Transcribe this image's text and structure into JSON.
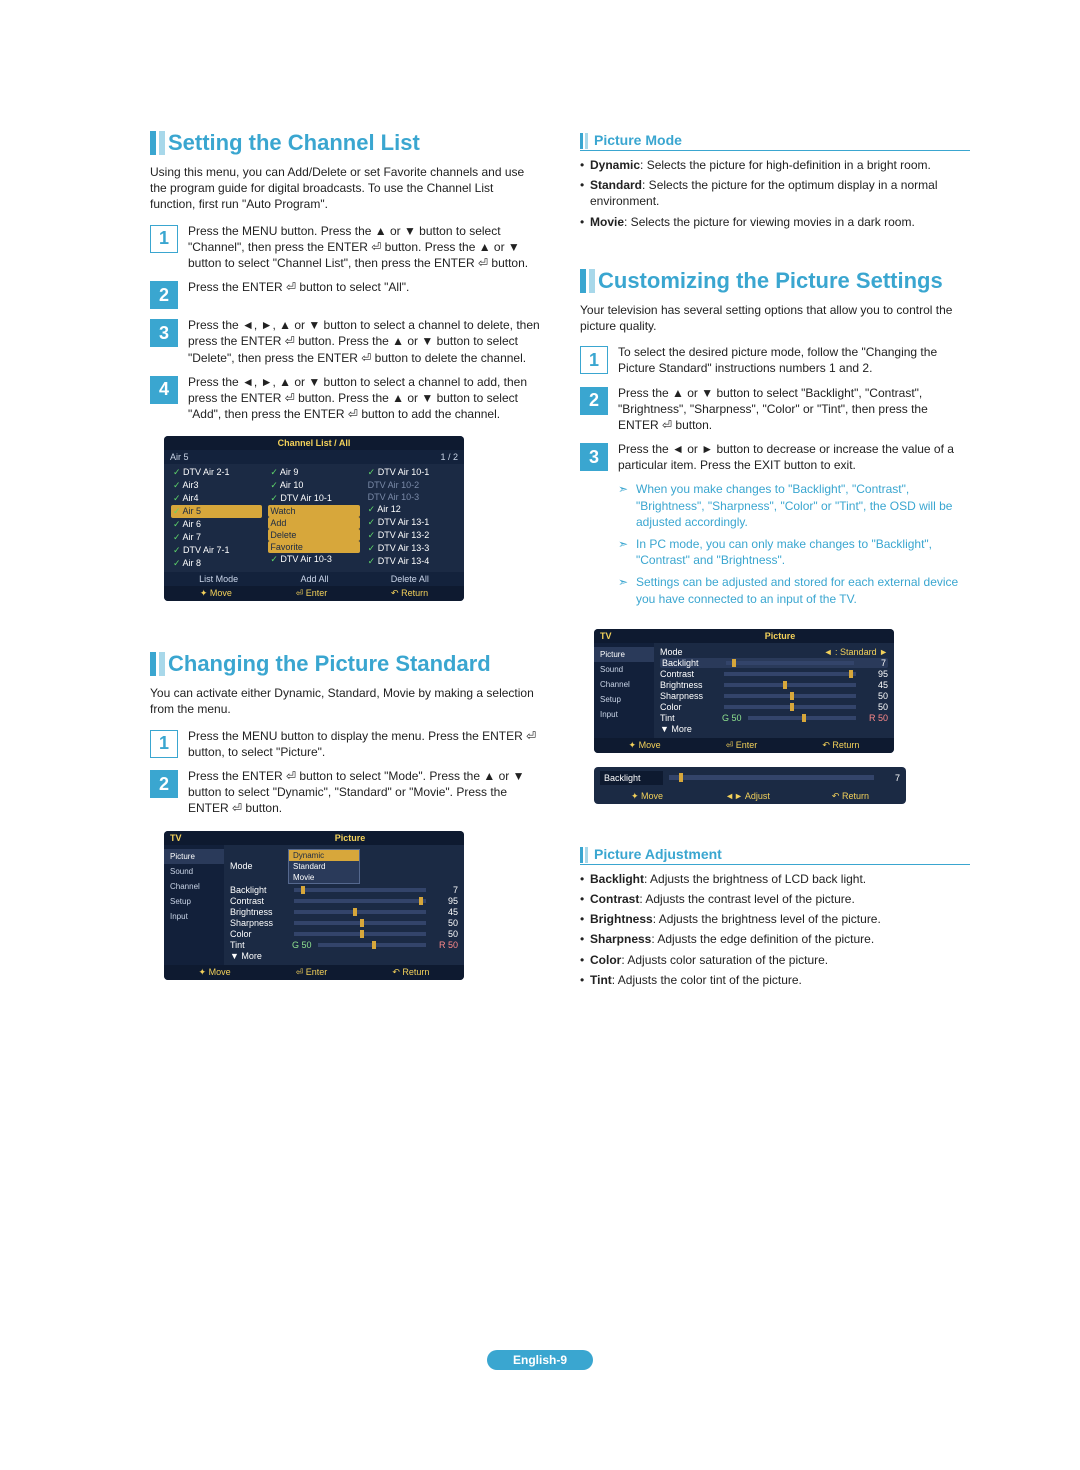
{
  "left": {
    "h1a": "Setting the Channel List",
    "intro_a": "Using this menu, you can Add/Delete or set Favorite channels and use the program guide for digital broadcasts. To use the Channel List function, first run \"Auto Program\".",
    "steps_a": {
      "1": "Press the MENU button. Press the ▲ or ▼ button to select \"Channel\", then press the ENTER ⏎ button. Press the ▲ or ▼ button to select \"Channel List\", then press the ENTER ⏎ button.",
      "2": "Press the ENTER ⏎ button to select \"All\".",
      "3": "Press the ◄, ►, ▲ or ▼ button to select a channel to delete, then press the ENTER ⏎ button. Press the ▲ or ▼ button to select \"Delete\", then press the ENTER ⏎ button to delete the channel.",
      "4": "Press the ◄, ►, ▲ or ▼ button to select a channel to add, then press the ENTER ⏎ button. Press the ▲ or ▼ button to select \"Add\", then press the ENTER ⏎ button to add the channel."
    },
    "osd_a": {
      "title": "Channel List / All",
      "sub_l": "Air 5",
      "sub_r": "1 / 2",
      "col1": [
        "DTV Air 2-1",
        "Air3",
        "Air4",
        "Air 5",
        "Air 6",
        "Air 7",
        "DTV Air 7-1",
        "Air 8"
      ],
      "col2": [
        "Air 9",
        "Air 10",
        "DTV Air 10-1",
        "Watch",
        "Add",
        "Delete",
        "Favorite",
        "DTV Air 10-3"
      ],
      "col3": [
        "DTV Air 10-1",
        "DTV Air 10-2",
        "DTV Air 10-3",
        "Air 12",
        "DTV Air 13-1",
        "DTV Air 13-2",
        "DTV Air 13-3",
        "DTV Air 13-4"
      ],
      "foot": [
        "List Mode",
        "Add All",
        "Delete All"
      ],
      "foot2": [
        "✦ Move",
        "⏎ Enter",
        "↶ Return"
      ]
    },
    "h1b": "Changing the Picture Standard",
    "intro_b": "You can activate either Dynamic, Standard, Movie by making a selection from the menu.",
    "steps_b": {
      "1": "Press the MENU button to display the menu. Press the ENTER ⏎ button, to select \"Picture\".",
      "2": "Press the ENTER ⏎ button to select \"Mode\". Press the ▲ or ▼ button to select \"Dynamic\", \"Standard\" or \"Movie\". Press the ENTER ⏎ button."
    },
    "osd_b": {
      "tv": "TV",
      "title": "Picture",
      "side": [
        "Picture",
        "Sound",
        "Channel",
        "Setup",
        "Input"
      ],
      "lines": [
        {
          "label": "Mode",
          "drop": [
            "Dynamic",
            "Standard",
            "Movie"
          ]
        },
        {
          "label": "Backlight",
          "val": "7",
          "s": "s5"
        },
        {
          "label": "Contrast",
          "val": "95",
          "s": "s95"
        },
        {
          "label": "Brightness",
          "val": "45",
          "s": "s45"
        },
        {
          "label": "Sharpness",
          "val": "50",
          "s": "s50"
        },
        {
          "label": "Color",
          "val": "50",
          "s": "s50"
        },
        {
          "label": "Tint",
          "pre": "G 50",
          "val": "R 50",
          "s": "s50"
        },
        {
          "label": "▼ More"
        }
      ],
      "foot": [
        "✦ Move",
        "⏎ Enter",
        "↶ Return"
      ]
    }
  },
  "right": {
    "h2a": "Picture Mode",
    "pm": [
      {
        "b": "Dynamic",
        "t": ": Selects the picture for high-definition in a bright room."
      },
      {
        "b": "Standard",
        "t": ": Selects the picture for the optimum display in a normal environment."
      },
      {
        "b": "Movie",
        "t": ": Selects the picture for viewing movies in a dark room."
      }
    ],
    "h1c": "Customizing the Picture Settings",
    "intro_c": "Your television has several setting options that allow you to control the picture quality.",
    "steps_c": {
      "1": "To select the desired picture mode, follow the \"Changing the Picture Standard\" instructions numbers 1 and 2.",
      "2": "Press the ▲ or ▼ button to select \"Backlight\", \"Contrast\", \"Brightness\", \"Sharpness\", \"Color\" or \"Tint\", then press the ENTER ⏎ button.",
      "3": "Press the ◄ or ► button to decrease or increase the value of a particular item. Press the EXIT button to exit."
    },
    "notes": [
      "When you make changes to \"Backlight\", \"Contrast\", \"Brightness\", \"Sharpness\", \"Color\" or \"Tint\", the OSD will be adjusted accordingly.",
      "In PC mode, you can only make changes to \"Backlight\", \"Contrast\" and \"Brightness\".",
      "Settings can be adjusted and stored for each external device you have connected to an input of the TV."
    ],
    "osd_c": {
      "tv": "TV",
      "title": "Picture",
      "side": [
        "Picture",
        "Sound",
        "Channel",
        "Setup",
        "Input"
      ],
      "lines": [
        {
          "label": "Mode",
          "right": ": Standard"
        },
        {
          "label": "Backlight",
          "val": "7",
          "s": "s5",
          "hi": true
        },
        {
          "label": "Contrast",
          "val": "95",
          "s": "s95"
        },
        {
          "label": "Brightness",
          "val": "45",
          "s": "s45"
        },
        {
          "label": "Sharpness",
          "val": "50",
          "s": "s50"
        },
        {
          "label": "Color",
          "val": "50",
          "s": "s50"
        },
        {
          "label": "Tint",
          "pre": "G 50",
          "val": "R 50",
          "s": "s50"
        },
        {
          "label": "▼ More"
        }
      ],
      "foot": [
        "✦ Move",
        "⏎ Enter",
        "↶ Return"
      ]
    },
    "mini": {
      "label": "Backlight",
      "val": "7",
      "foot": [
        "✦ Move",
        "◄► Adjust",
        "↶ Return"
      ]
    },
    "h2b": "Picture Adjustment",
    "pa": [
      {
        "b": "Backlight",
        "t": ": Adjusts the brightness of LCD back light."
      },
      {
        "b": "Contrast",
        "t": ": Adjusts the contrast level of the picture."
      },
      {
        "b": "Brightness",
        "t": ": Adjusts the brightness level of the picture."
      },
      {
        "b": "Sharpness",
        "t": ": Adjusts the edge definition of the picture."
      },
      {
        "b": "Color",
        "t": ": Adjusts color saturation of the picture."
      },
      {
        "b": "Tint",
        "t": ": Adjusts the color tint of the picture."
      }
    ]
  },
  "page": "English-9"
}
